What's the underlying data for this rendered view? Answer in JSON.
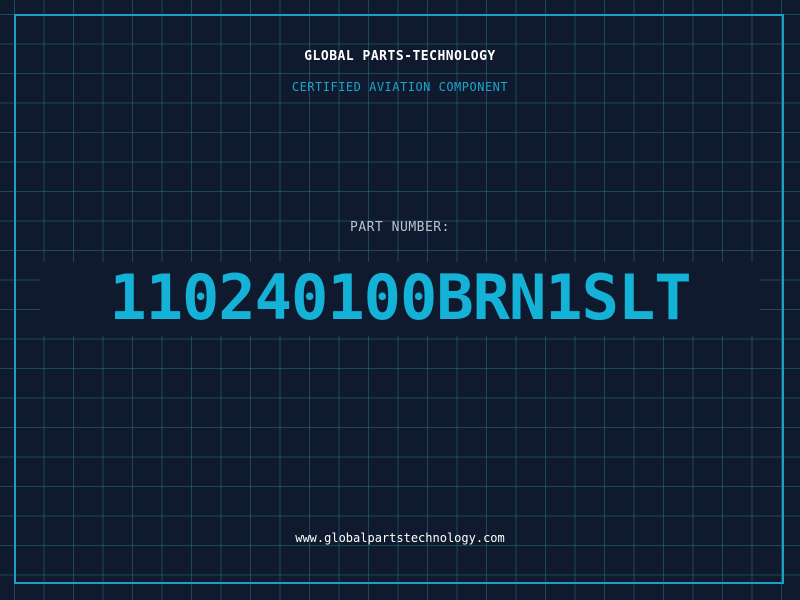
{
  "company": "GLOBAL PARTS-TECHNOLOGY",
  "subtitle": "CERTIFIED AVIATION COMPONENT",
  "part_label": "PART NUMBER:",
  "part_number": "110240100BRN1SLT",
  "website": "www.globalpartstechnology.com",
  "colors": {
    "background": "#101a2e",
    "grid": "#286e82",
    "frame": "#1d9fc4",
    "accent": "#15b2d8",
    "text": "#ffffff"
  }
}
